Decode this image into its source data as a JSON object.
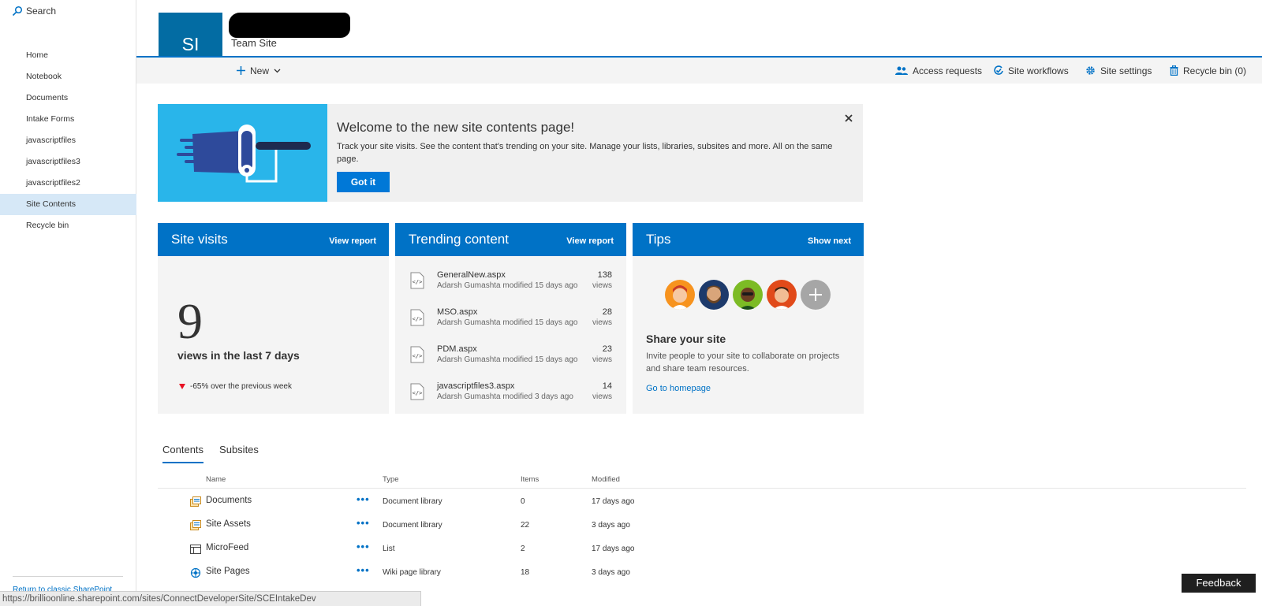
{
  "nav": {
    "search_label": "Search",
    "items": [
      {
        "label": "Home"
      },
      {
        "label": "Notebook"
      },
      {
        "label": "Documents"
      },
      {
        "label": "Intake Forms"
      },
      {
        "label": "javascriptfiles"
      },
      {
        "label": "javascriptfiles3"
      },
      {
        "label": "javascriptfiles2"
      },
      {
        "label": "Site Contents"
      },
      {
        "label": "Recycle bin"
      }
    ],
    "selected_item": "Site Contents",
    "classic_link": "Return to classic SharePoint"
  },
  "header": {
    "logo_initials": "SI",
    "site_subtitle": "Team Site"
  },
  "commandbar": {
    "new_label": "New",
    "access_requests": "Access requests",
    "site_workflows": "Site workflows",
    "site_settings": "Site settings",
    "recycle_bin": "Recycle bin (0)"
  },
  "banner": {
    "title": "Welcome to the new site contents page!",
    "description": "Track your site visits. See the content that's trending on your site. Manage your lists, libraries, subsites and more. All on the same page.",
    "button": "Got it"
  },
  "cards": {
    "site_visits": {
      "title": "Site visits",
      "link": "View report",
      "count": "9",
      "label": "views in the last 7 days",
      "change": "-65% over the previous week"
    },
    "trending": {
      "title": "Trending content",
      "link": "View report",
      "items": [
        {
          "name": "GeneralNew.aspx",
          "meta": "Adarsh Gumashta modified 15 days ago",
          "count": "138",
          "unit": "views"
        },
        {
          "name": "MSO.aspx",
          "meta": "Adarsh Gumashta modified 15 days ago",
          "count": "28",
          "unit": "views"
        },
        {
          "name": "PDM.aspx",
          "meta": "Adarsh Gumashta modified 15 days ago",
          "count": "23",
          "unit": "views"
        },
        {
          "name": "javascriptfiles3.aspx",
          "meta": "Adarsh Gumashta modified 3 days ago",
          "count": "14",
          "unit": "views"
        }
      ]
    },
    "tips": {
      "title": "Tips",
      "link": "Show next",
      "heading": "Share your site",
      "description": "Invite people to your site to collaborate on projects and share team resources.",
      "action": "Go to homepage"
    }
  },
  "contents": {
    "tabs": [
      "Contents",
      "Subsites"
    ],
    "active_tab": "Contents",
    "columns": {
      "name": "Name",
      "type": "Type",
      "items": "Items",
      "modified": "Modified"
    },
    "more_label": "•••",
    "rows": [
      {
        "name": "Documents",
        "type": "Document library",
        "items": "0",
        "modified": "17 days ago",
        "icon": "document-library-icon"
      },
      {
        "name": "Site Assets",
        "type": "Document library",
        "items": "22",
        "modified": "3 days ago",
        "icon": "document-library-icon"
      },
      {
        "name": "MicroFeed",
        "type": "List",
        "items": "2",
        "modified": "17 days ago",
        "icon": "list-icon"
      },
      {
        "name": "Site Pages",
        "type": "Wiki page library",
        "items": "18",
        "modified": "3 days ago",
        "icon": "wiki-library-icon"
      }
    ]
  },
  "status_url": "https://brillioonline.sharepoint.com/sites/ConnectDeveloperSite/SCEIntakeDev",
  "feedback_label": "Feedback",
  "colors": {
    "accent": "#0072c6",
    "logo_bg": "#036ca3",
    "banner_art_bg": "#29b5ea",
    "nav_selected": "#d6e8f7",
    "down_arrow": "#e81123"
  }
}
